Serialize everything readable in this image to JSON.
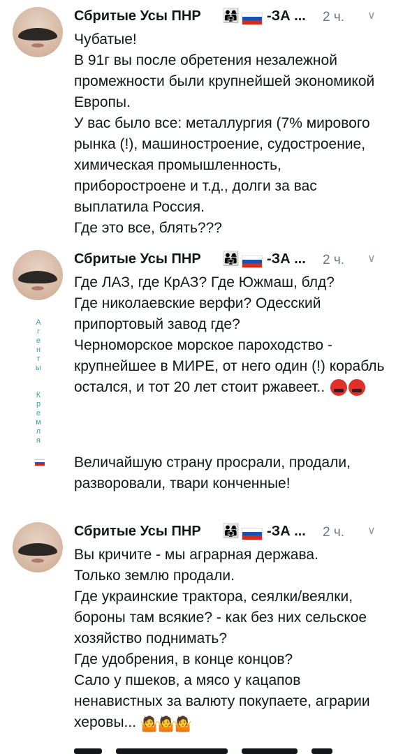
{
  "tweets": [
    {
      "author": "Сбритые Усы ПНР",
      "suffix": "-ЗА ...",
      "time": "2 ч.",
      "family_emoji": "👨‍👩‍👧",
      "body": "Чубатые!\nВ 91г вы после обретения незалежной промежности были крупнейшей экономикой Европы.\nУ вас было все: металлургия (7% мирового рынка (!), машиностроение, судостроение, химическая промышленность, приборостроене и т.д., долги за вас выплатила Россия.\nГде это все, блять???"
    },
    {
      "author": "Сбритые Усы ПНР",
      "suffix": "-ЗА ...",
      "time": "2 ч.",
      "family_emoji": "👨‍👩‍👧",
      "body_part1": "Где ЛАЗ, где КрАЗ? Где Южмаш, блд?\nГде николаевские верфи? Одесский припортовый завод где?\nЧерноморское морское пароходство - крупнейшее в МИРЕ, от него один (!) корабль остался, и тот 20 лет стоит ржавеет.. ",
      "body_part2": "Величайшую страну просрали, продали, разворовали, твари конченные!",
      "side_tag": "Агенты Кремля"
    },
    {
      "author": "Сбритые Усы ПНР",
      "suffix": "-ЗА ...",
      "time": "2 ч.",
      "family_emoji": "👨‍👩‍👧",
      "body": "Вы кричите - мы аграрная держава.\nТолько землю продали.\nГде украинские трактора, сеялки/веялки, бороны там всякие? - как без них сельское хозяйство поднимать?\nГде удобрения, в конце концов?\nСало у пшеков, а мясо у кацапов ненавистных за валюту покупаете, аграрии херовы... "
    }
  ],
  "icons": {
    "chevron": "chevron-down-icon",
    "flag": "russia-flag-icon",
    "angry": "angry-face-icon",
    "person": "person-emoji-icon"
  },
  "colors": {
    "text": "#14171a",
    "muted": "#657786",
    "flag_blue": "#1a4fb4",
    "flag_red": "#d52b1e"
  }
}
